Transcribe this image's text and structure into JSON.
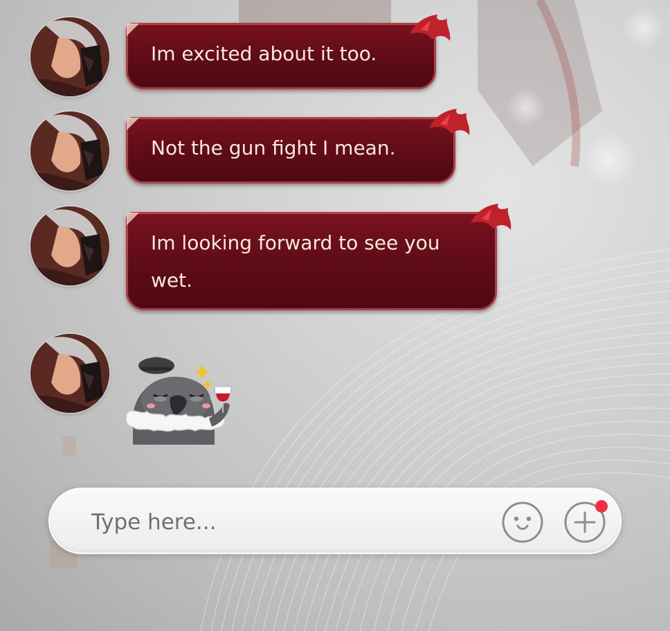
{
  "chat": {
    "messages": [
      {
        "type": "text",
        "text": "Im excited about it too."
      },
      {
        "type": "text",
        "text": "Not the gun fight I mean."
      },
      {
        "type": "text",
        "text": "Im looking forward to see you wet."
      },
      {
        "type": "sticker",
        "icon": "crow-with-wine-glass-sticker"
      }
    ]
  },
  "composer": {
    "placeholder": "Type here...",
    "value": "",
    "emoji_icon": "smiley-face-icon",
    "plus_icon": "plus-circle-icon",
    "has_notification": true
  },
  "colors": {
    "bubble_fill": "#5e0b18",
    "bubble_border": "#b8383f",
    "bubble_text": "#f7ead8",
    "notification_dot": "#ee3140"
  }
}
